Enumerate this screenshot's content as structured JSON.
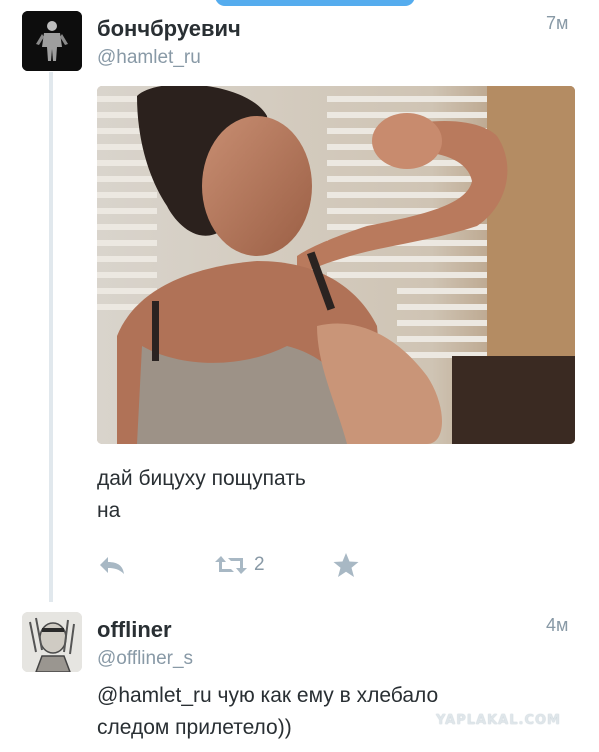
{
  "tweets": [
    {
      "display_name": "бончбруевич",
      "handle": "@hamlet_ru",
      "time": "7м",
      "text_lines": [
        "дай бицуху пощупать",
        "на"
      ],
      "retweet_count": "2"
    },
    {
      "display_name": "offliner",
      "handle": "@offliner_s",
      "time": "4м",
      "text_lines": [
        "@hamlet_ru чую как ему в хлебало",
        "следом прилетело))"
      ]
    }
  ],
  "watermark": "YAPLAKAL.COM",
  "colors": {
    "accent": "#55acee",
    "muted": "#8899a6",
    "icon": "#a8b8c4",
    "thread": "#e1e8ed"
  },
  "icons": [
    "reply-icon",
    "retweet-icon",
    "favorite-icon"
  ]
}
